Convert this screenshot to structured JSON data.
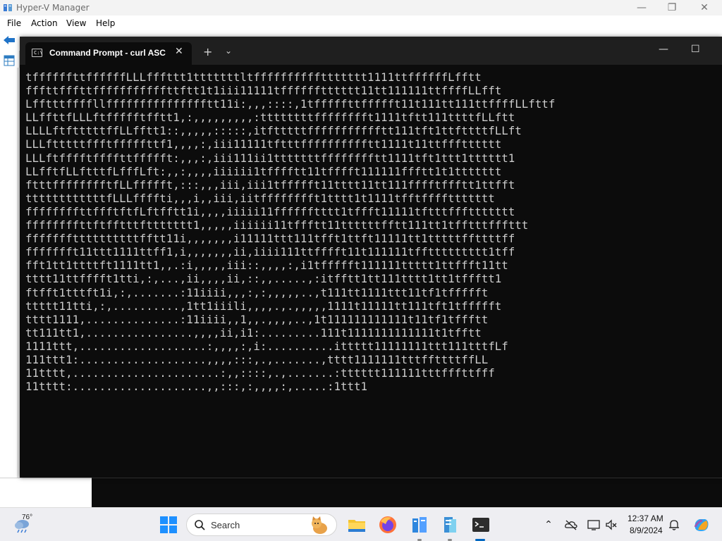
{
  "background_app": {
    "title": "Hyper-V Manager",
    "menu": [
      "File",
      "Action",
      "View",
      "Help"
    ],
    "window_controls": {
      "minimize": "—",
      "restore": "❐",
      "close": "✕"
    }
  },
  "terminal": {
    "tab_title": "Command Prompt - curl  ASC",
    "tab_icon_text": "C:\\",
    "tab_close": "✕",
    "new_tab": "+",
    "dropdown": "⌄",
    "window_controls": {
      "minimize": "—",
      "maximize": "☐"
    },
    "output_lines": [
      "tffffffttffffffLLLfffttt1tttttttltffffffffffttttttt1111ttffffffLfftt",
      "fffttfffttfffffffffffttftt1t1iii11111tfffffftttttt11tt111111ttffffLLfft",
      "Lfftttffffllffffffffffffffftt11i:,,,::::,1tfffffttffffft11t111tt111ttffffLLfttf",
      "LLffttfLLLftffffftfftt1,:,,,,,,,,,:ttttttttfffffffft1111tftt111ttttfLLftt",
      "LLLLftftttttffLLfftt1::,,,,,:::::,itftttttffffffffffftt111tft1ttfttttfLLft",
      "LLLftttttffftfffffttf1,,,,:,iii11111tftttfffffffffftt1111t11ttffftttttt",
      "LLLftfffftffffttffffft:,,,:,iii111ii1tttttttfffffffftt1111tft1ttt1tttttt1",
      "LLfftfLLftttfLfffLft:,,:,,,,iiiiii1tfffftt11tfffft111111ffftt1t1ttttttt",
      "ftttfffffffftfLLffffft,:::,,,iii,iii1tffffft11tttt11tt111fffftffftt1ttfft",
      "ttttttttttttfLLLffffti,,,i,,iii,iitfffffffft1tttt1t1111tfftffffttttttt",
      "ffffffffttffftftfLftfftt1i,,,,iiiii11fffffftttt1tffft11111tftttfffttttttt",
      "ffffffffttftfftttfttttttt1,,,,,iiiiii11tffftt11ttttttfftt111tt1tfftttfffttt",
      "fffffffttttttttttfftt11i,,,,,,,i11111ttt111tfft1ttft11111tt1tttttffttttff",
      "ffffffft11ttt1111ttff1,i,,,,,,,ii,iiii111ttfffft11t111111tffttttttttt1tff",
      "fft1tt1ttttft1111tt1,,.:i,,,,,iii::,,,,:,i1tffffft111111ttttt1ttffft11tt",
      "tttt11ttfffft1tti,:,...,ii,,,,ii,::,,.....,:itfftt1tt111tttt1tt1tffftt1",
      "ftfft1tttft1i,:,.......:11iiii,,,:,:,,,,,..,t111tt1111ttt11tf1tffffft",
      "ttttt11tti,:,..........,1tt1iiili,,,,.,.,,,,,1111t11111tt111tft1tffffft",
      "tttt1111,..............:11iiii,,1,,.,,,,..,1t111111111111t11tf1tffftt",
      "tt111tt1,................,,,,ii,i1:.........111t1111111111111t1tfftt",
      "1111ttt,...................:,,,,:,i:..........ittttt11111111ttt111tttfLf",
      "111ttt1:...................,,,,:::,.,.......,tttt1111111tttffttttffLL",
      "11tttt,......................:,,::::,.,.......:tttttt111111tttfffttfff",
      "11tttt:....................,,:::,:,,,,:,.....:1ttt1"
    ]
  },
  "taskbar": {
    "weather_temp": "76°",
    "search_placeholder": "Search",
    "clock_time": "12:37 AM",
    "clock_date": "8/9/2024",
    "colors": {
      "active_indicator": "#0067c0"
    }
  }
}
